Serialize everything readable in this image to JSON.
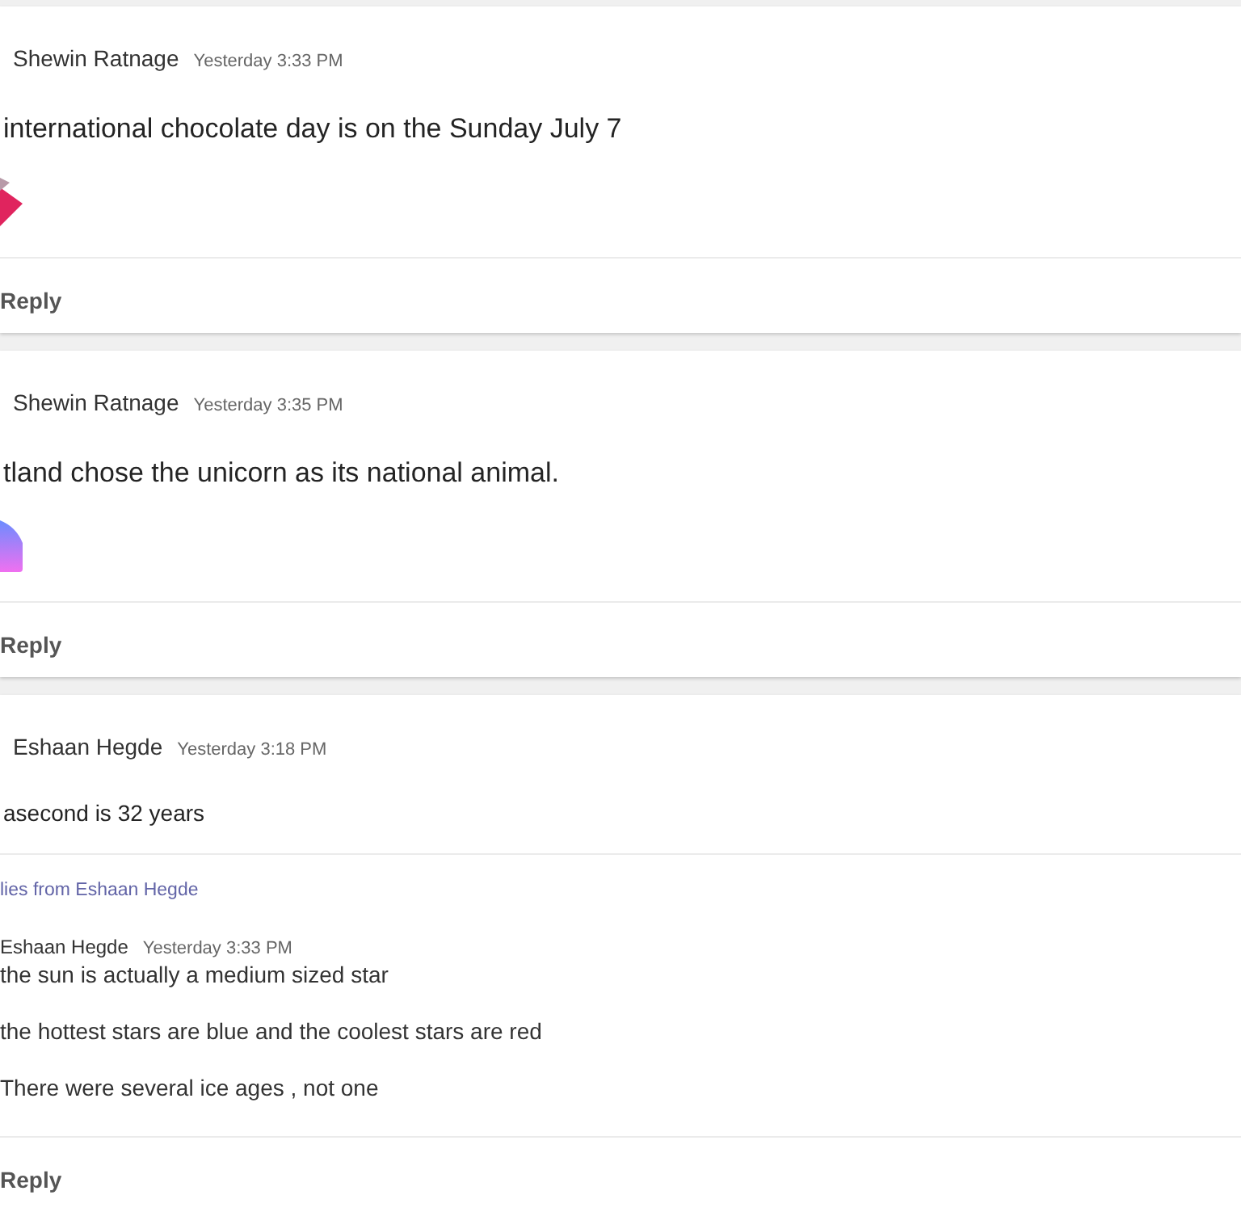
{
  "posts": [
    {
      "kind": "sticker",
      "author": "Shewin Ratnage",
      "time": "Yesterday 3:33 PM",
      "body": "international chocolate day is on the Sunday July 7",
      "sticker": {
        "kind": "chocolate"
      },
      "reply_button": "Reply"
    },
    {
      "kind": "sticker",
      "author": "Shewin Ratnage",
      "time": "Yesterday 3:35 PM",
      "body": "tland chose the unicorn as its national animal.",
      "sticker": {
        "kind": "unicorn"
      },
      "reply_button": "Reply"
    },
    {
      "kind": "thread",
      "author": "Eshaan Hegde",
      "time": "Yesterday 3:18 PM",
      "body": "asecond is 32 years",
      "replies_link": "lies from Eshaan Hegde",
      "replies": [
        {
          "author": "Eshaan Hegde",
          "time": "Yesterday 3:33 PM",
          "lines": [
            "the sun is actually a medium sized star",
            "the hottest stars are blue and the coolest stars are red",
            "There were several ice ages , not one"
          ]
        }
      ],
      "reply_button": "Reply"
    }
  ]
}
